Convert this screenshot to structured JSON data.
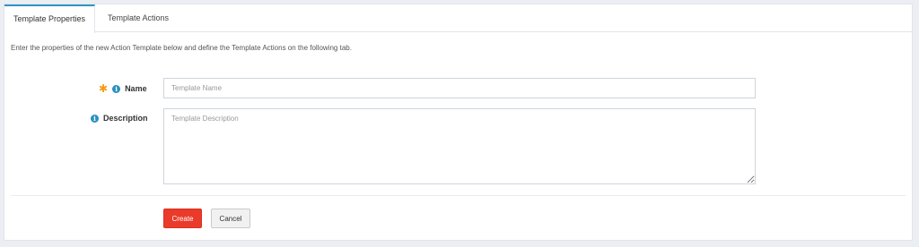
{
  "tabs": [
    {
      "label": "Template Properties",
      "active": true
    },
    {
      "label": "Template Actions",
      "active": false
    }
  ],
  "intro_text": "Enter the properties of the new Action Template below and define the Template Actions on the following tab.",
  "form": {
    "name": {
      "label": "Name",
      "required": true,
      "placeholder": "Template Name",
      "value": ""
    },
    "description": {
      "label": "Description",
      "required": false,
      "placeholder": "Template Description",
      "value": ""
    }
  },
  "buttons": {
    "create_label": "Create",
    "cancel_label": "Cancel"
  },
  "icons": {
    "required": "asterisk-icon",
    "info": "info-circle-icon"
  },
  "colors": {
    "accent": "#2b95c5",
    "primary_button": "#ea3a2a",
    "required": "#f39c12"
  }
}
